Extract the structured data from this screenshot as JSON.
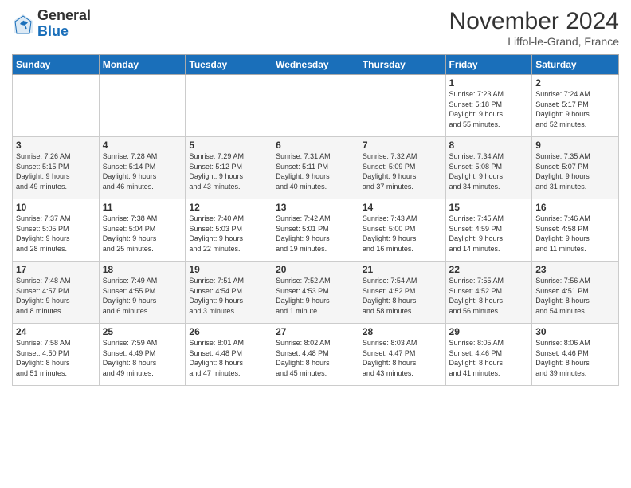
{
  "logo": {
    "general": "General",
    "blue": "Blue"
  },
  "title": "November 2024",
  "location": "Liffol-le-Grand, France",
  "days_of_week": [
    "Sunday",
    "Monday",
    "Tuesday",
    "Wednesday",
    "Thursday",
    "Friday",
    "Saturday"
  ],
  "rows": [
    [
      {
        "num": "",
        "info": ""
      },
      {
        "num": "",
        "info": ""
      },
      {
        "num": "",
        "info": ""
      },
      {
        "num": "",
        "info": ""
      },
      {
        "num": "",
        "info": ""
      },
      {
        "num": "1",
        "info": "Sunrise: 7:23 AM\nSunset: 5:18 PM\nDaylight: 9 hours\nand 55 minutes."
      },
      {
        "num": "2",
        "info": "Sunrise: 7:24 AM\nSunset: 5:17 PM\nDaylight: 9 hours\nand 52 minutes."
      }
    ],
    [
      {
        "num": "3",
        "info": "Sunrise: 7:26 AM\nSunset: 5:15 PM\nDaylight: 9 hours\nand 49 minutes."
      },
      {
        "num": "4",
        "info": "Sunrise: 7:28 AM\nSunset: 5:14 PM\nDaylight: 9 hours\nand 46 minutes."
      },
      {
        "num": "5",
        "info": "Sunrise: 7:29 AM\nSunset: 5:12 PM\nDaylight: 9 hours\nand 43 minutes."
      },
      {
        "num": "6",
        "info": "Sunrise: 7:31 AM\nSunset: 5:11 PM\nDaylight: 9 hours\nand 40 minutes."
      },
      {
        "num": "7",
        "info": "Sunrise: 7:32 AM\nSunset: 5:09 PM\nDaylight: 9 hours\nand 37 minutes."
      },
      {
        "num": "8",
        "info": "Sunrise: 7:34 AM\nSunset: 5:08 PM\nDaylight: 9 hours\nand 34 minutes."
      },
      {
        "num": "9",
        "info": "Sunrise: 7:35 AM\nSunset: 5:07 PM\nDaylight: 9 hours\nand 31 minutes."
      }
    ],
    [
      {
        "num": "10",
        "info": "Sunrise: 7:37 AM\nSunset: 5:05 PM\nDaylight: 9 hours\nand 28 minutes."
      },
      {
        "num": "11",
        "info": "Sunrise: 7:38 AM\nSunset: 5:04 PM\nDaylight: 9 hours\nand 25 minutes."
      },
      {
        "num": "12",
        "info": "Sunrise: 7:40 AM\nSunset: 5:03 PM\nDaylight: 9 hours\nand 22 minutes."
      },
      {
        "num": "13",
        "info": "Sunrise: 7:42 AM\nSunset: 5:01 PM\nDaylight: 9 hours\nand 19 minutes."
      },
      {
        "num": "14",
        "info": "Sunrise: 7:43 AM\nSunset: 5:00 PM\nDaylight: 9 hours\nand 16 minutes."
      },
      {
        "num": "15",
        "info": "Sunrise: 7:45 AM\nSunset: 4:59 PM\nDaylight: 9 hours\nand 14 minutes."
      },
      {
        "num": "16",
        "info": "Sunrise: 7:46 AM\nSunset: 4:58 PM\nDaylight: 9 hours\nand 11 minutes."
      }
    ],
    [
      {
        "num": "17",
        "info": "Sunrise: 7:48 AM\nSunset: 4:57 PM\nDaylight: 9 hours\nand 8 minutes."
      },
      {
        "num": "18",
        "info": "Sunrise: 7:49 AM\nSunset: 4:55 PM\nDaylight: 9 hours\nand 6 minutes."
      },
      {
        "num": "19",
        "info": "Sunrise: 7:51 AM\nSunset: 4:54 PM\nDaylight: 9 hours\nand 3 minutes."
      },
      {
        "num": "20",
        "info": "Sunrise: 7:52 AM\nSunset: 4:53 PM\nDaylight: 9 hours\nand 1 minute."
      },
      {
        "num": "21",
        "info": "Sunrise: 7:54 AM\nSunset: 4:52 PM\nDaylight: 8 hours\nand 58 minutes."
      },
      {
        "num": "22",
        "info": "Sunrise: 7:55 AM\nSunset: 4:52 PM\nDaylight: 8 hours\nand 56 minutes."
      },
      {
        "num": "23",
        "info": "Sunrise: 7:56 AM\nSunset: 4:51 PM\nDaylight: 8 hours\nand 54 minutes."
      }
    ],
    [
      {
        "num": "24",
        "info": "Sunrise: 7:58 AM\nSunset: 4:50 PM\nDaylight: 8 hours\nand 51 minutes."
      },
      {
        "num": "25",
        "info": "Sunrise: 7:59 AM\nSunset: 4:49 PM\nDaylight: 8 hours\nand 49 minutes."
      },
      {
        "num": "26",
        "info": "Sunrise: 8:01 AM\nSunset: 4:48 PM\nDaylight: 8 hours\nand 47 minutes."
      },
      {
        "num": "27",
        "info": "Sunrise: 8:02 AM\nSunset: 4:48 PM\nDaylight: 8 hours\nand 45 minutes."
      },
      {
        "num": "28",
        "info": "Sunrise: 8:03 AM\nSunset: 4:47 PM\nDaylight: 8 hours\nand 43 minutes."
      },
      {
        "num": "29",
        "info": "Sunrise: 8:05 AM\nSunset: 4:46 PM\nDaylight: 8 hours\nand 41 minutes."
      },
      {
        "num": "30",
        "info": "Sunrise: 8:06 AM\nSunset: 4:46 PM\nDaylight: 8 hours\nand 39 minutes."
      }
    ]
  ]
}
